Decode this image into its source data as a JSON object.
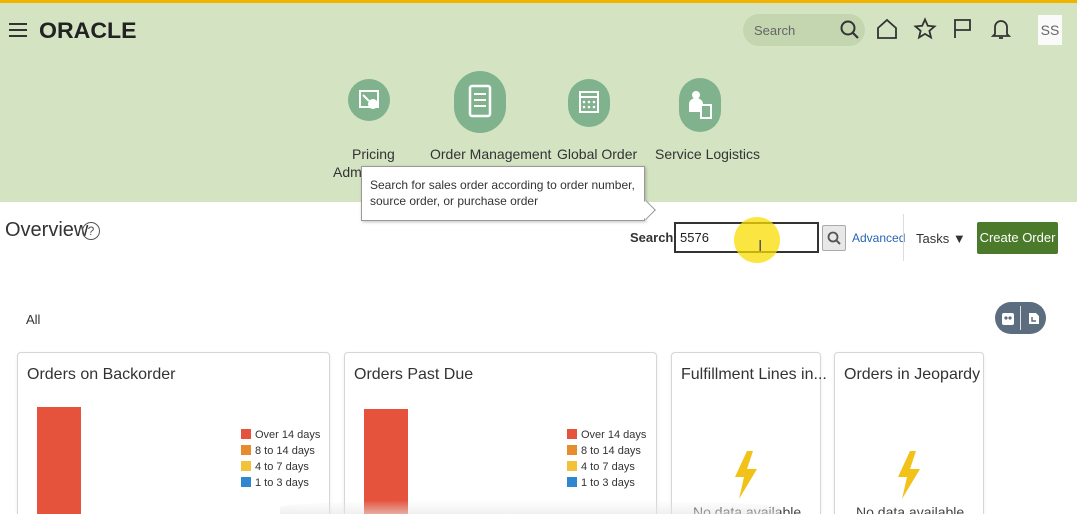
{
  "header": {
    "logo": "ORACLE",
    "search_placeholder": "Search",
    "user_initials": "SS",
    "accent_color": "#d4e4c3"
  },
  "apps": [
    {
      "label": "Pricing",
      "label2": "Admi",
      "icon": "pricing-icon"
    },
    {
      "label": "Order Management",
      "icon": "document-list-icon"
    },
    {
      "label": "Global Order",
      "icon": "calendar-icon"
    },
    {
      "label": "Service Logistics",
      "icon": "person-device-icon"
    }
  ],
  "tooltip": {
    "text": "Search for sales order according to order number, source order, or purchase order"
  },
  "overview": {
    "title": "Overview",
    "help": "?"
  },
  "search": {
    "label": "Search",
    "value": "5576",
    "advanced": "Advanced",
    "tasks": "Tasks ▼",
    "create": "Create Order"
  },
  "filter": {
    "all": "All"
  },
  "legend": [
    "Over 14 days",
    "8 to 14 days",
    "4 to 7 days",
    "1 to 3 days"
  ],
  "legend_colors": [
    "#e5533d",
    "#e88a2e",
    "#f2c23a",
    "#2f87d0"
  ],
  "cards": [
    {
      "title": "Orders on Backorder"
    },
    {
      "title": "Orders Past Due"
    },
    {
      "title": "Fulfillment Lines in...",
      "nodata": "No data available"
    },
    {
      "title": "Orders in Jeopardy",
      "nodata": "No data available"
    }
  ]
}
